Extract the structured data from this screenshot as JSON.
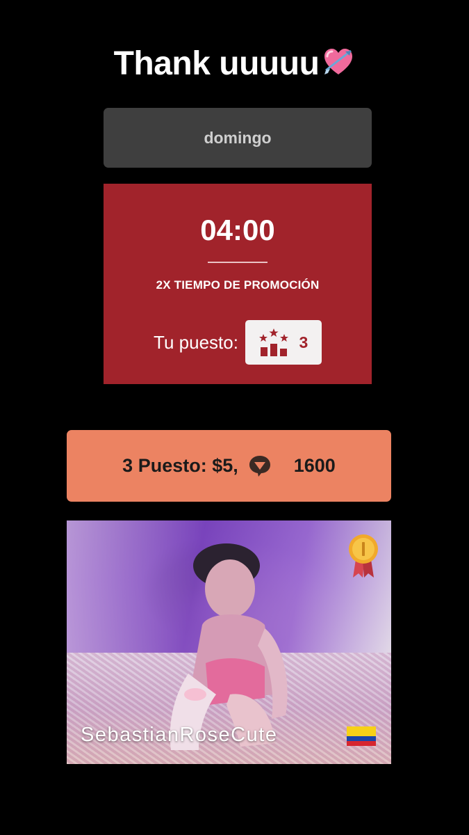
{
  "story": {
    "caption": "Thank uuuuu",
    "caption_emoji": "heart-with-arrow-icon"
  },
  "promo": {
    "day": "domingo",
    "timer": "04:00",
    "promotion_label": "2X TIEMPO DE PROMOCIÓN",
    "rank_label": "Tu puesto:",
    "rank_icon": "podium-stars-icon",
    "rank_value": "3"
  },
  "result": {
    "place_prize": "3 Puesto: $5,",
    "tip_icon": "token-bubble-icon",
    "tokens": "1600"
  },
  "model": {
    "username": "SebastianRoseCute",
    "badge_icon": "gold-medal-icon",
    "country_flag": "colombia-flag-icon"
  },
  "colors": {
    "background": "#000000",
    "day_pill": "#3f3f3f",
    "promo_card": "#a1232b",
    "result_pill": "#ec8362",
    "rank_badge": "#f3f1f1"
  }
}
